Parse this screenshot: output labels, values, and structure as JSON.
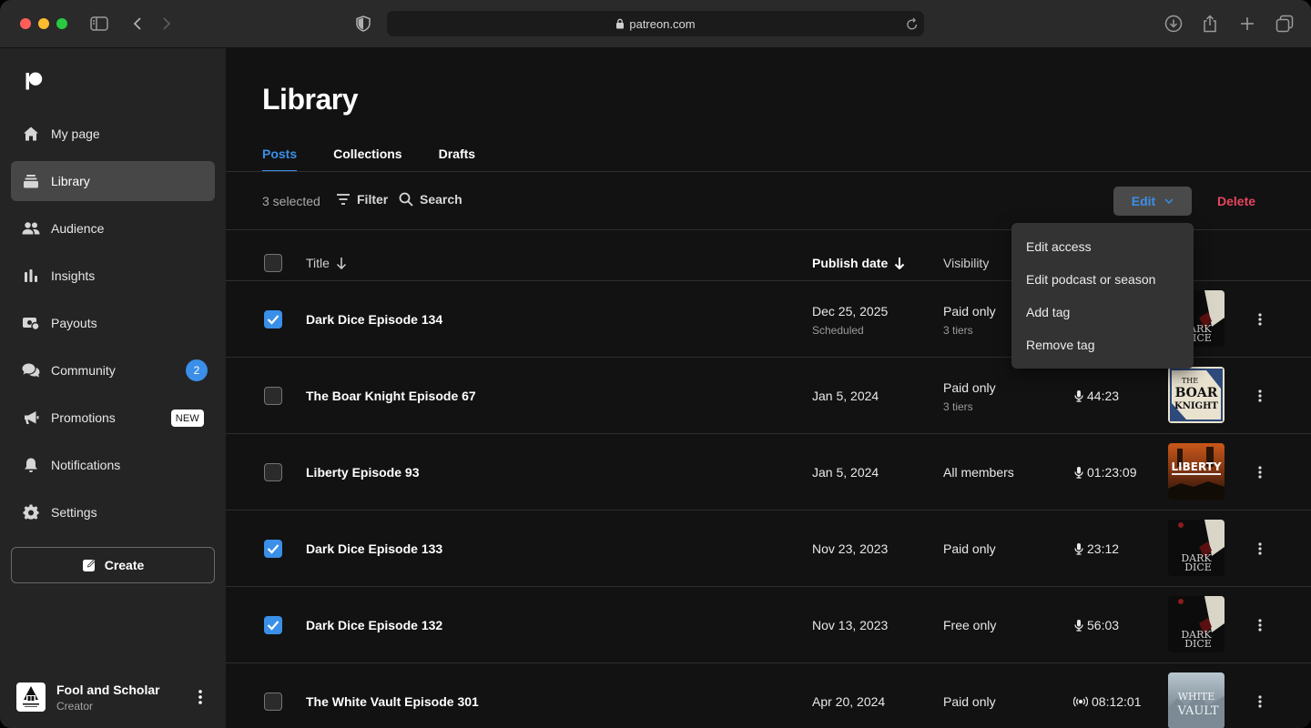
{
  "browser": {
    "url": "patreon.com"
  },
  "sidebar": {
    "items": [
      {
        "label": "My page",
        "icon": "home-icon"
      },
      {
        "label": "Library",
        "icon": "library-icon",
        "active": true
      },
      {
        "label": "Audience",
        "icon": "audience-icon"
      },
      {
        "label": "Insights",
        "icon": "insights-icon"
      },
      {
        "label": "Payouts",
        "icon": "payouts-icon"
      },
      {
        "label": "Community",
        "icon": "community-icon",
        "badge": "2"
      },
      {
        "label": "Promotions",
        "icon": "megaphone-icon",
        "tag": "NEW"
      },
      {
        "label": "Notifications",
        "icon": "bell-icon"
      },
      {
        "label": "Settings",
        "icon": "gear-icon"
      }
    ],
    "create_label": "Create",
    "profile": {
      "name": "Fool and Scholar",
      "role": "Creator"
    }
  },
  "main": {
    "title": "Library",
    "tabs": [
      {
        "label": "Posts",
        "active": true
      },
      {
        "label": "Collections"
      },
      {
        "label": "Drafts"
      }
    ],
    "toolbar": {
      "selected": "3 selected",
      "filter": "Filter",
      "search": "Search",
      "edit": "Edit",
      "delete": "Delete"
    },
    "columns": {
      "title": "Title",
      "publish_date": "Publish date",
      "visibility": "Visibility"
    },
    "rows": [
      {
        "title": "Dark Dice Episode 134",
        "date": "Dec 25, 2025",
        "date_sub": "Scheduled",
        "visibility": "Paid only",
        "visibility_sub": "3 tiers",
        "duration": "",
        "checked": true,
        "art": "dark-dice"
      },
      {
        "title": "The Boar Knight Episode 67",
        "date": "Jan 5, 2024",
        "date_sub": "",
        "visibility": "Paid only",
        "visibility_sub": "3 tiers",
        "duration": "44:23",
        "checked": false,
        "art": "boar-knight"
      },
      {
        "title": "Liberty Episode 93",
        "date": "Jan 5, 2024",
        "date_sub": "",
        "visibility": "All members",
        "visibility_sub": "",
        "duration": "01:23:09",
        "checked": false,
        "art": "liberty"
      },
      {
        "title": "Dark Dice Episode 133",
        "date": "Nov 23, 2023",
        "date_sub": "",
        "visibility": "Paid only",
        "visibility_sub": "",
        "duration": "23:12",
        "checked": true,
        "art": "dark-dice"
      },
      {
        "title": "Dark Dice Episode 132",
        "date": "Nov 13, 2023",
        "date_sub": "",
        "visibility": "Free only",
        "visibility_sub": "",
        "duration": "56:03",
        "checked": true,
        "art": "dark-dice"
      },
      {
        "title": "The White Vault Episode 301",
        "date": "Apr 20, 2024",
        "date_sub": "",
        "visibility": "Paid only",
        "visibility_sub": "",
        "duration": "08:12:01",
        "checked": false,
        "art": "white-vault"
      }
    ],
    "art_text": {
      "dark_dice": [
        "DARK",
        "DICE"
      ],
      "boar_knight": [
        "THE",
        "BOAR",
        "KNIGHT"
      ],
      "liberty": "LIBERTY",
      "white_vault": [
        "WHITE",
        "VAULT"
      ]
    },
    "edit_menu": [
      "Edit access",
      "Edit podcast or season",
      "Add tag",
      "Remove tag"
    ]
  },
  "colors": {
    "accent": "#3a8fe8",
    "danger": "#e8455e",
    "background": "#121212",
    "sidebar": "#242424"
  }
}
